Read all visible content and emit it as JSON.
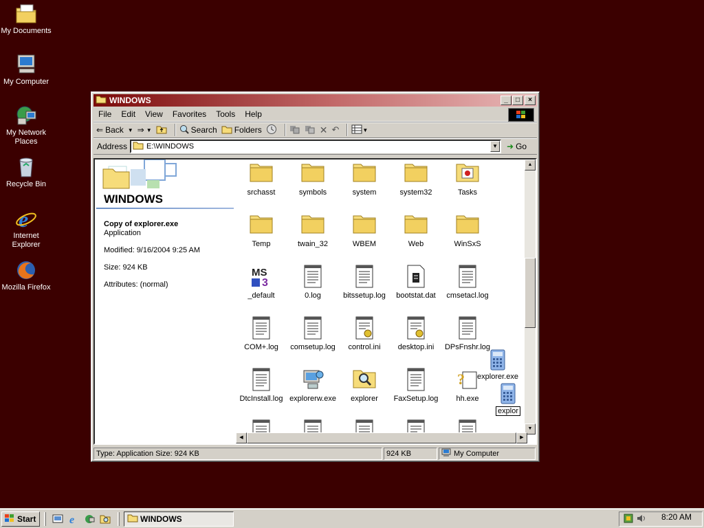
{
  "desktop": {
    "icons": [
      {
        "label": "My Documents",
        "icon": "my-documents-icon"
      },
      {
        "label": "My Computer",
        "icon": "my-computer-icon"
      },
      {
        "label": "My Network Places",
        "icon": "network-places-icon"
      },
      {
        "label": "Recycle Bin",
        "icon": "recycle-bin-icon"
      },
      {
        "label": "Internet Explorer",
        "icon": "internet-explorer-icon"
      },
      {
        "label": "Mozilla Firefox",
        "icon": "firefox-icon"
      }
    ],
    "background_color": "#3b0000"
  },
  "window": {
    "title": "WINDOWS",
    "menu": [
      "File",
      "Edit",
      "View",
      "Favorites",
      "Tools",
      "Help"
    ],
    "toolbar": {
      "back": "Back",
      "search": "Search",
      "folders": "Folders"
    },
    "address": {
      "label": "Address",
      "value": "E:\\WINDOWS",
      "go": "Go"
    },
    "left_pane": {
      "folder_title": "WINDOWS",
      "selected_name": "Copy of explorer.exe",
      "selected_type": "Application",
      "modified": "Modified: 9/16/2004 9:25 AM",
      "size": "Size: 924 KB",
      "attributes": "Attributes: (normal)"
    },
    "files": [
      {
        "name": "srchasst",
        "icon": "folder-icon"
      },
      {
        "name": "symbols",
        "icon": "folder-icon"
      },
      {
        "name": "system",
        "icon": "folder-icon"
      },
      {
        "name": "system32",
        "icon": "folder-icon"
      },
      {
        "name": "Tasks",
        "icon": "tasks-folder-icon"
      },
      {
        "name": "Temp",
        "icon": "folder-icon"
      },
      {
        "name": "twain_32",
        "icon": "folder-icon"
      },
      {
        "name": "WBEM",
        "icon": "folder-icon"
      },
      {
        "name": "Web",
        "icon": "folder-icon"
      },
      {
        "name": "WinSxS",
        "icon": "folder-icon"
      },
      {
        "name": "_default",
        "icon": "ms-document-icon"
      },
      {
        "name": "0.log",
        "icon": "text-file-icon"
      },
      {
        "name": "bitssetup.log",
        "icon": "text-file-icon"
      },
      {
        "name": "bootstat.dat",
        "icon": "dat-file-icon"
      },
      {
        "name": "cmsetacl.log",
        "icon": "text-file-icon"
      },
      {
        "name": "COM+.log",
        "icon": "text-file-icon"
      },
      {
        "name": "comsetup.log",
        "icon": "text-file-icon"
      },
      {
        "name": "control.ini",
        "icon": "ini-file-icon"
      },
      {
        "name": "desktop.ini",
        "icon": "ini-file-icon"
      },
      {
        "name": "DPsFnshr.log",
        "icon": "text-file-icon"
      },
      {
        "name": "DtcInstall.log",
        "icon": "text-file-icon"
      },
      {
        "name": "explorerw.exe",
        "icon": "computer-exe-icon"
      },
      {
        "name": "explorer",
        "icon": "search-folder-icon"
      },
      {
        "name": "FaxSetup.log",
        "icon": "text-file-icon"
      },
      {
        "name": "hh.exe",
        "icon": "help-exe-icon"
      }
    ],
    "dragging": {
      "name": "explorer.exe",
      "rename_value": "explor"
    },
    "status": {
      "type_size": "Type: Application Size: 924 KB",
      "size": "924 KB",
      "zone": "My Computer"
    }
  },
  "taskbar": {
    "start": "Start",
    "task": "WINDOWS",
    "clock": "8:20 AM"
  }
}
